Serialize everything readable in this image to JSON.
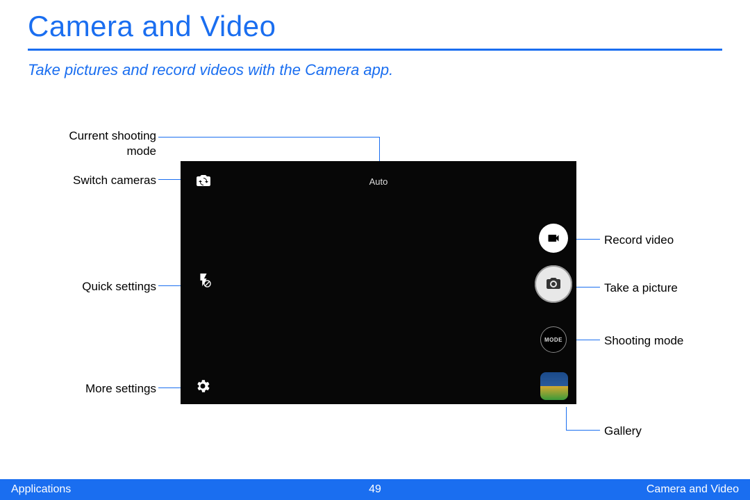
{
  "header": {
    "title": "Camera and Video",
    "subtitle": "Take pictures and record videos with the Camera app."
  },
  "camera": {
    "mode_label": "Auto",
    "mode_button_text": "MODE"
  },
  "callouts": {
    "current_shooting_mode": "Current shooting\nmode",
    "switch_cameras": "Switch cameras",
    "quick_settings": "Quick settings",
    "more_settings": "More settings",
    "record_video": "Record video",
    "take_a_picture": "Take a picture",
    "shooting_mode": "Shooting mode",
    "gallery": "Gallery"
  },
  "footer": {
    "left": "Applications",
    "page": "49",
    "right": "Camera and Video"
  }
}
